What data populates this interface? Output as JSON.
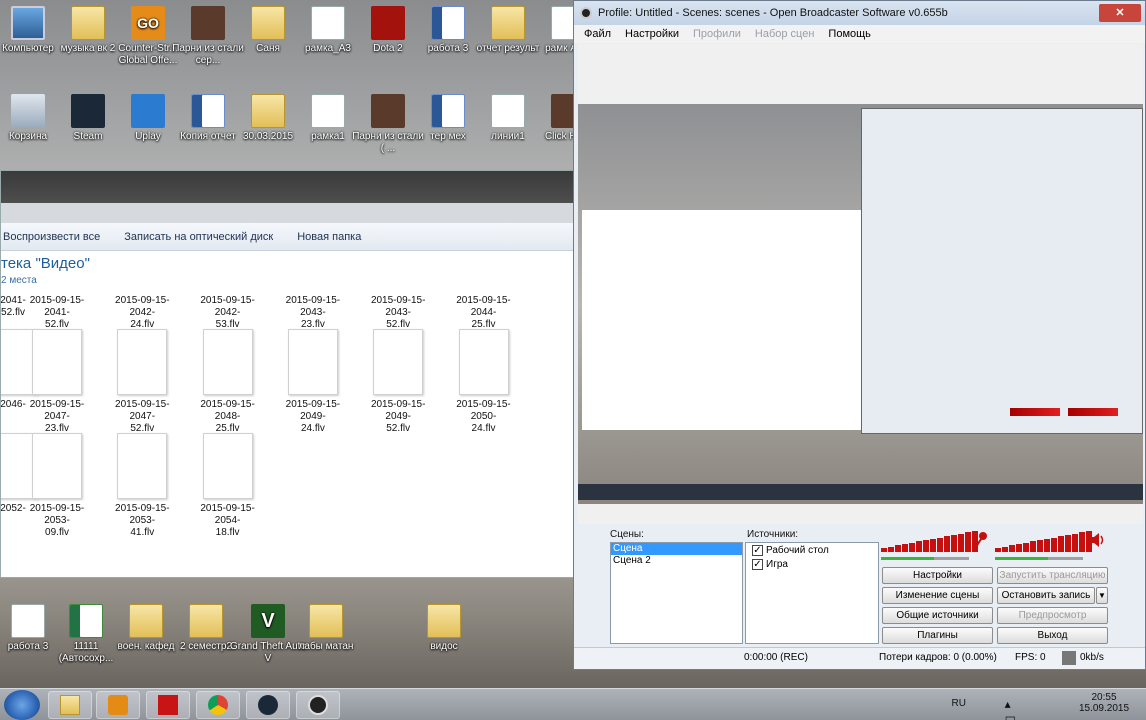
{
  "desktop": {
    "icons_row1": [
      "Компьютер",
      "музыка вк 2",
      "Counter-Str... Global Offe...",
      "Парни из стали сер...",
      "Саня",
      "рамка_A3",
      "Dota 2",
      "работа 3",
      "отчет результ",
      "рамк A3.b"
    ],
    "icons_row2": [
      "Корзина",
      "Steam",
      "Uplay",
      "Копия отчет",
      "30.03.2015",
      "рамка1",
      "Парни из стали ( ...",
      "тер мех",
      "линии1",
      "Click Hero"
    ],
    "icons_bottom": [
      "работа 3",
      "11111 (Автосохр...",
      "воен. кафед",
      "2 семестр2",
      "Grand Theft Auto V",
      "лабы матан",
      "видос"
    ]
  },
  "explorer": {
    "toolbar": [
      "Воспроизвести все",
      "Записать на оптический диск",
      "Новая папка"
    ],
    "library_title": "тека \"Видео\"",
    "library_sub": "2 места",
    "files_row1": [
      "2041-\n52.flv",
      "2015-09-15-2041-\n52.flv",
      "2015-09-15-2042-\n24.flv",
      "2015-09-15-2042-\n53.flv",
      "2015-09-15-2043-\n23.flv",
      "2015-09-15-2043-\n52.flv",
      "2015-09-15-2044-\n25.flv"
    ],
    "files_row2": [
      "2046-",
      "2015-09-15-2047-\n23.flv",
      "2015-09-15-2047-\n52.flv",
      "2015-09-15-2048-\n25.flv",
      "2015-09-15-2049-\n24.flv",
      "2015-09-15-2049-\n52.flv",
      "2015-09-15-2050-\n24.flv"
    ],
    "files_row3": [
      "2052-",
      "2015-09-15-2053-\n09.flv",
      "2015-09-15-2053-\n41.flv",
      "2015-09-15-2054-\n18.flv"
    ]
  },
  "obs": {
    "title": "Profile: Untitled - Scenes: scenes - Open Broadcaster Software v0.655b",
    "menu": {
      "file": "Файл",
      "settings": "Настройки",
      "profiles": "Профили",
      "scene_sets": "Набор сцен",
      "help": "Помощь"
    },
    "scenes_label": "Сцены:",
    "sources_label": "Источники:",
    "scenes": [
      "Сцена",
      "Сцена 2"
    ],
    "sources": [
      "Рабочий стол",
      "Игра"
    ],
    "buttons": {
      "settings": "Настройки",
      "start_stream": "Запустить трансляцию",
      "edit_scene": "Изменение сцены",
      "stop_record": "Остановить запись",
      "global_sources": "Общие источники",
      "preview": "Предпросмотр",
      "plugins": "Плагины",
      "exit": "Выход"
    },
    "status": {
      "time": "0:00:00 (REC)",
      "dropped": "Потери кадров: 0 (0.00%)",
      "fps": "FPS: 0",
      "kbps": "0kb/s"
    }
  },
  "tray": {
    "lang": "RU",
    "time": "20:55",
    "date": "15.09.2015"
  },
  "colors": {
    "accent": "#3399ff",
    "meter": "#c60f0f",
    "close": "#c7453a"
  }
}
